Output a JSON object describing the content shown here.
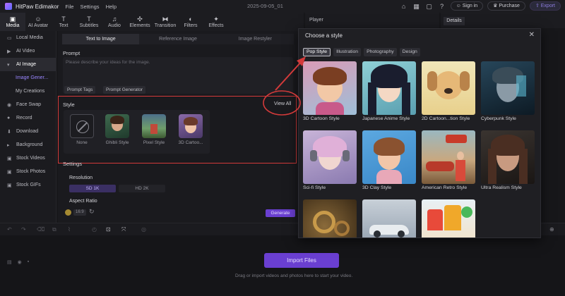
{
  "titlebar": {
    "app_name": "HitPaw Edimakor",
    "menu": [
      "File",
      "Settings",
      "Help"
    ],
    "doc_title": "2025-09-05_01",
    "sign_in": "Sign in",
    "purchase": "Purchase",
    "export": "Export"
  },
  "toolbar": [
    {
      "label": "Media",
      "icon": "media-icon"
    },
    {
      "label": "AI Avatar",
      "icon": "avatar-icon"
    },
    {
      "label": "Text",
      "icon": "text-icon"
    },
    {
      "label": "Subtitles",
      "icon": "subtitles-icon"
    },
    {
      "label": "Audio",
      "icon": "audio-icon"
    },
    {
      "label": "Elements",
      "icon": "elements-icon"
    },
    {
      "label": "Transition",
      "icon": "transition-icon"
    },
    {
      "label": "Filters",
      "icon": "filters-icon"
    },
    {
      "label": "Effects",
      "icon": "effects-icon"
    }
  ],
  "sidebar": {
    "items": [
      {
        "label": "Local Media"
      },
      {
        "label": "AI Video"
      },
      {
        "label": "AI Image"
      },
      {
        "label": "Image Gener..."
      },
      {
        "label": "My Creations"
      },
      {
        "label": "Face Swap"
      },
      {
        "label": "Record"
      },
      {
        "label": "Download"
      },
      {
        "label": "Background"
      },
      {
        "label": "Stock Videos"
      },
      {
        "label": "Stock Photos"
      },
      {
        "label": "Stock GIFs"
      }
    ]
  },
  "main": {
    "subtabs": [
      "Text to Image",
      "Reference Image",
      "Image Restyler"
    ],
    "prompt_label": "Prompt",
    "prompt_placeholder": "Please describe your ideas for the image.",
    "prompt_tags": "Prompt Tags",
    "prompt_generator": "Prompt Generator",
    "style_label": "Style",
    "view_all": "View All",
    "style_options": [
      "None",
      "Ghibli Style",
      "Pixel Style",
      "3D Cartoo..."
    ],
    "settings_label": "Settings",
    "resolution_label": "Resolution",
    "res_sd": "SD 1K",
    "res_hd": "HD 2K",
    "aspect_label": "Aspect Ratio",
    "aspect_value": "16:9",
    "generate": "Generate"
  },
  "player": {
    "label": "Player"
  },
  "details": {
    "label": "Details"
  },
  "timeline": {
    "import_button": "Import Files",
    "hint": "Drag or import videos and photos here to start your video."
  },
  "modal": {
    "title": "Choose a style",
    "tabs": [
      "Pop Style",
      "Illustration",
      "Photography",
      "Design"
    ],
    "cards": [
      {
        "label": "3D Cartoon Style"
      },
      {
        "label": "Japanese Anime Style"
      },
      {
        "label": "2D Cartoon...tion Style"
      },
      {
        "label": "Cyberpunk Style"
      },
      {
        "label": "Sci-fi Style"
      },
      {
        "label": "3D Clay Style"
      },
      {
        "label": "American Retro Style"
      },
      {
        "label": "Ultra Realism Style"
      },
      {
        "label": ""
      },
      {
        "label": ""
      },
      {
        "label": ""
      }
    ]
  },
  "colors": {
    "accent": "#6a3fd1",
    "annotation": "#d33a3a"
  }
}
